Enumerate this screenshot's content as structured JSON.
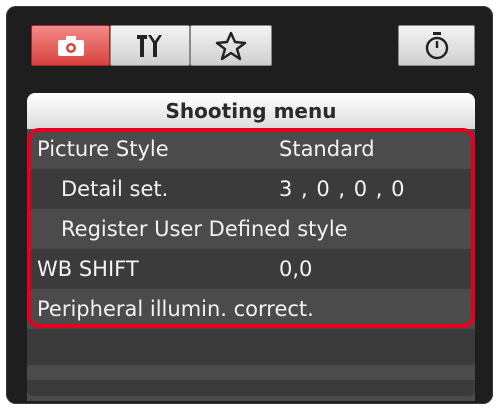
{
  "tabs": [
    {
      "icon": "camera-icon",
      "active": true
    },
    {
      "icon": "tools-icon",
      "active": false
    },
    {
      "icon": "star-icon",
      "active": false
    },
    {
      "icon": "timer-icon",
      "active": false
    }
  ],
  "menu": {
    "title": "Shooting menu",
    "items": [
      {
        "label": "Picture Style",
        "value": "Standard"
      },
      {
        "label": "Detail set.",
        "value": "3 , 0 , 0 , 0"
      },
      {
        "label": "Register User Defined style",
        "value": ""
      },
      {
        "label": "WB SHIFT",
        "value": "0,0"
      },
      {
        "label": "Peripheral illumin. correct.",
        "value": ""
      }
    ]
  },
  "colors": {
    "active_tab": "#d9423e",
    "highlight_border": "#e6001f"
  }
}
